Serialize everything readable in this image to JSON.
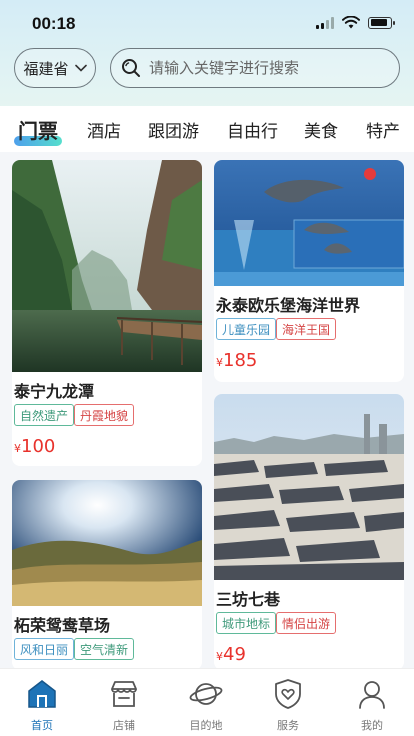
{
  "status_bar": {
    "time": "00:18"
  },
  "search": {
    "province": "福建省",
    "placeholder": "请输入关键字进行搜索"
  },
  "tabs": [
    {
      "label": "门票",
      "active": true
    },
    {
      "label": "酒店"
    },
    {
      "label": "跟团游"
    },
    {
      "label": "自由行"
    },
    {
      "label": "美食"
    },
    {
      "label": "特产"
    }
  ],
  "cards": [
    {
      "name": "泰宁九龙潭",
      "tags": [
        "自然遗产",
        "丹霞地貌"
      ],
      "currency": "¥",
      "price": "100"
    },
    {
      "name": "永泰欧乐堡海洋世界",
      "tags": [
        "儿童乐园",
        "海洋王国"
      ],
      "currency": "¥",
      "price": "185"
    },
    {
      "name": "柘荣鸳鸯草场",
      "tags": [
        "风和日丽",
        "空气清新"
      ],
      "currency": "¥",
      "price": ""
    },
    {
      "name": "三坊七巷",
      "tags": [
        "城市地标",
        "情侣出游"
      ],
      "currency": "¥",
      "price": "49"
    }
  ],
  "bottom_nav": [
    {
      "label": "首页",
      "icon": "home-icon",
      "active": true
    },
    {
      "label": "店铺",
      "icon": "store-icon"
    },
    {
      "label": "目的地",
      "icon": "planet-icon"
    },
    {
      "label": "服务",
      "icon": "shield-heart-icon"
    },
    {
      "label": "我的",
      "icon": "user-icon"
    }
  ],
  "colors": {
    "accent": "#1d73b7",
    "price": "#e8322c"
  }
}
